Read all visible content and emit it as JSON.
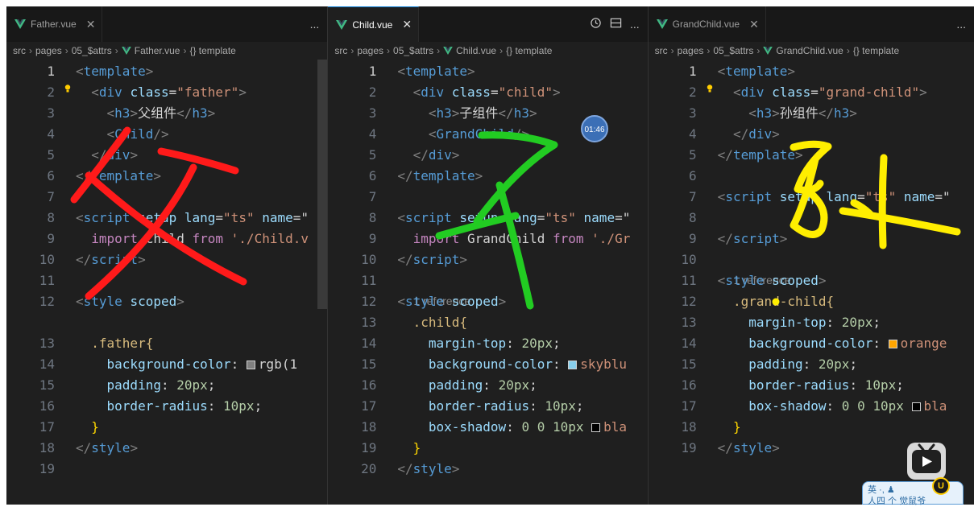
{
  "panes": [
    {
      "tab": {
        "name": "Father.vue",
        "active": false
      },
      "actions": [
        "..."
      ],
      "breadcrumb": [
        "src",
        "pages",
        "05_$attrs",
        "Father.vue",
        "{} template"
      ],
      "lines": [
        {
          "n": "1",
          "tokens": [
            [
              "<",
              "br"
            ],
            [
              "template",
              "tag"
            ],
            [
              ">",
              "br"
            ]
          ]
        },
        {
          "n": "2",
          "tokens": [
            [
              "  <",
              "br"
            ],
            [
              "div",
              "tag"
            ],
            [
              " class",
              "attr"
            ],
            [
              "=",
              "plain"
            ],
            [
              "\"father\"",
              "str"
            ],
            [
              ">",
              "br"
            ]
          ],
          "bulb": true
        },
        {
          "n": "3",
          "tokens": [
            [
              "    <",
              "br"
            ],
            [
              "h3",
              "tag"
            ],
            [
              ">",
              "br"
            ],
            [
              "父组件",
              "txt"
            ],
            [
              "</",
              "br"
            ],
            [
              "h3",
              "tag"
            ],
            [
              ">",
              "br"
            ]
          ]
        },
        {
          "n": "4",
          "tokens": [
            [
              "    <",
              "br"
            ],
            [
              "Child",
              "tag"
            ],
            [
              "/>",
              "br"
            ]
          ]
        },
        {
          "n": "5",
          "tokens": [
            [
              "  </",
              "br"
            ],
            [
              "div",
              "tag"
            ],
            [
              ">",
              "br"
            ]
          ]
        },
        {
          "n": "6",
          "tokens": [
            [
              "</",
              "br"
            ],
            [
              "template",
              "tag"
            ],
            [
              ">",
              "br"
            ]
          ]
        },
        {
          "n": "7",
          "tokens": []
        },
        {
          "n": "8",
          "tokens": [
            [
              "<",
              "br"
            ],
            [
              "script",
              "tag"
            ],
            [
              " setup",
              "attr"
            ],
            [
              " lang",
              "attr"
            ],
            [
              "=",
              "plain"
            ],
            [
              "\"ts\"",
              "str"
            ],
            [
              " name",
              "attr"
            ],
            [
              "=\"",
              "plain"
            ]
          ]
        },
        {
          "n": "9",
          "tokens": [
            [
              "  import",
              "kw"
            ],
            [
              " Child",
              "plain"
            ],
            [
              " from",
              "kw"
            ],
            [
              " './Child.v",
              "str"
            ]
          ]
        },
        {
          "n": "10",
          "tokens": [
            [
              "</",
              "br"
            ],
            [
              "script",
              "tag"
            ],
            [
              ">",
              "br"
            ]
          ]
        },
        {
          "n": "11",
          "tokens": []
        },
        {
          "n": "12",
          "tokens": [
            [
              "<",
              "br"
            ],
            [
              "style",
              "tag"
            ],
            [
              " scoped",
              "attr"
            ],
            [
              ">",
              "br"
            ]
          ]
        },
        {
          "n": "13",
          "tokens": [
            [
              "  .father{",
              "sel"
            ]
          ],
          "gap": true
        },
        {
          "n": "14",
          "tokens": [
            [
              "    background-color",
              "prop"
            ],
            [
              ": ",
              "plain"
            ],
            [
              "SW",
              "#808080"
            ],
            [
              "rgb(1",
              "plain"
            ]
          ]
        },
        {
          "n": "15",
          "tokens": [
            [
              "    padding",
              "prop"
            ],
            [
              ": ",
              "plain"
            ],
            [
              "20px",
              "num"
            ],
            [
              ";",
              "plain"
            ]
          ]
        },
        {
          "n": "16",
          "tokens": [
            [
              "    border-radius",
              "prop"
            ],
            [
              ": ",
              "plain"
            ],
            [
              "10px",
              "num"
            ],
            [
              ";",
              "plain"
            ]
          ]
        },
        {
          "n": "17",
          "tokens": [
            [
              "  }",
              "gold"
            ]
          ]
        },
        {
          "n": "18",
          "tokens": [
            [
              "</",
              "br"
            ],
            [
              "style",
              "tag"
            ],
            [
              ">",
              "br"
            ]
          ]
        },
        {
          "n": "19",
          "tokens": []
        }
      ],
      "current_line": "1"
    },
    {
      "tab": {
        "name": "Child.vue",
        "active": true
      },
      "actions": [
        "history",
        "split",
        "..."
      ],
      "breadcrumb": [
        "src",
        "pages",
        "05_$attrs",
        "Child.vue",
        "{} template"
      ],
      "lines": [
        {
          "n": "1",
          "tokens": [
            [
              "<",
              "br"
            ],
            [
              "template",
              "tag"
            ],
            [
              ">",
              "br"
            ]
          ]
        },
        {
          "n": "2",
          "tokens": [
            [
              "  <",
              "br"
            ],
            [
              "div",
              "tag"
            ],
            [
              " class",
              "attr"
            ],
            [
              "=",
              "plain"
            ],
            [
              "\"child\"",
              "str"
            ],
            [
              ">",
              "br"
            ]
          ]
        },
        {
          "n": "3",
          "tokens": [
            [
              "    <",
              "br"
            ],
            [
              "h3",
              "tag"
            ],
            [
              ">",
              "br"
            ],
            [
              "子组件",
              "txt"
            ],
            [
              "</",
              "br"
            ],
            [
              "h3",
              "tag"
            ],
            [
              ">",
              "br"
            ]
          ]
        },
        {
          "n": "4",
          "tokens": [
            [
              "    <",
              "br"
            ],
            [
              "GrandChild",
              "tag"
            ],
            [
              "/>",
              "br"
            ]
          ]
        },
        {
          "n": "5",
          "tokens": [
            [
              "  </",
              "br"
            ],
            [
              "div",
              "tag"
            ],
            [
              ">",
              "br"
            ]
          ]
        },
        {
          "n": "6",
          "tokens": [
            [
              "</",
              "br"
            ],
            [
              "template",
              "tag"
            ],
            [
              ">",
              "br"
            ]
          ]
        },
        {
          "n": "7",
          "tokens": []
        },
        {
          "n": "8",
          "tokens": [
            [
              "<",
              "br"
            ],
            [
              "script",
              "tag"
            ],
            [
              " setup",
              "attr"
            ],
            [
              " lang",
              "attr"
            ],
            [
              "=",
              "plain"
            ],
            [
              "\"ts\"",
              "str"
            ],
            [
              " name",
              "attr"
            ],
            [
              "=\"",
              "plain"
            ]
          ]
        },
        {
          "n": "9",
          "tokens": [
            [
              "  import",
              "kw"
            ],
            [
              " GrandChild",
              "plain"
            ],
            [
              " from",
              "kw"
            ],
            [
              " './Gr",
              "str"
            ]
          ]
        },
        {
          "n": "10",
          "tokens": [
            [
              "</",
              "br"
            ],
            [
              "script",
              "tag"
            ],
            [
              ">",
              "br"
            ]
          ]
        },
        {
          "n": "11",
          "tokens": []
        },
        {
          "n": "12",
          "tokens": [
            [
              "<",
              "br"
            ],
            [
              "style",
              "tag"
            ],
            [
              " scoped",
              "attr"
            ],
            [
              ">",
              "br"
            ]
          ],
          "ref": "1 reference"
        },
        {
          "n": "13",
          "tokens": [
            [
              "  .child{",
              "sel"
            ]
          ]
        },
        {
          "n": "14",
          "tokens": [
            [
              "    margin-top",
              "prop"
            ],
            [
              ": ",
              "plain"
            ],
            [
              "20px",
              "num"
            ],
            [
              ";",
              "plain"
            ]
          ]
        },
        {
          "n": "15",
          "tokens": [
            [
              "    background-color",
              "prop"
            ],
            [
              ": ",
              "plain"
            ],
            [
              "SW",
              "#87ceeb"
            ],
            [
              "skyblu",
              "str"
            ]
          ]
        },
        {
          "n": "16",
          "tokens": [
            [
              "    padding",
              "prop"
            ],
            [
              ": ",
              "plain"
            ],
            [
              "20px",
              "num"
            ],
            [
              ";",
              "plain"
            ]
          ]
        },
        {
          "n": "17",
          "tokens": [
            [
              "    border-radius",
              "prop"
            ],
            [
              ": ",
              "plain"
            ],
            [
              "10px",
              "num"
            ],
            [
              ";",
              "plain"
            ]
          ]
        },
        {
          "n": "18",
          "tokens": [
            [
              "    box-shadow",
              "prop"
            ],
            [
              ": ",
              "plain"
            ],
            [
              "0 0 10px ",
              "num"
            ],
            [
              "SW",
              "#000000"
            ],
            [
              "bla",
              "str"
            ]
          ]
        },
        {
          "n": "19",
          "tokens": [
            [
              "  }",
              "gold"
            ]
          ]
        },
        {
          "n": "20",
          "tokens": [
            [
              "</",
              "br"
            ],
            [
              "style",
              "tag"
            ],
            [
              ">",
              "br"
            ]
          ]
        }
      ],
      "current_line": "1",
      "timer": "01:46"
    },
    {
      "tab": {
        "name": "GrandChild.vue",
        "active": false
      },
      "actions": [
        "..."
      ],
      "breadcrumb": [
        "src",
        "pages",
        "05_$attrs",
        "GrandChild.vue",
        "{} template"
      ],
      "lines": [
        {
          "n": "1",
          "tokens": [
            [
              "<",
              "br"
            ],
            [
              "template",
              "tag"
            ],
            [
              ">",
              "br"
            ]
          ]
        },
        {
          "n": "2",
          "tokens": [
            [
              "  <",
              "br"
            ],
            [
              "div",
              "tag"
            ],
            [
              " class",
              "attr"
            ],
            [
              "=",
              "plain"
            ],
            [
              "\"grand-child\"",
              "str"
            ],
            [
              ">",
              "br"
            ]
          ],
          "bulb": true
        },
        {
          "n": "3",
          "tokens": [
            [
              "    <",
              "br"
            ],
            [
              "h3",
              "tag"
            ],
            [
              ">",
              "br"
            ],
            [
              "孙组件",
              "txt"
            ],
            [
              "</",
              "br"
            ],
            [
              "h3",
              "tag"
            ],
            [
              ">",
              "br"
            ]
          ]
        },
        {
          "n": "4",
          "tokens": [
            [
              "  </",
              "br"
            ],
            [
              "div",
              "tag"
            ],
            [
              ">",
              "br"
            ]
          ]
        },
        {
          "n": "5",
          "tokens": [
            [
              "</",
              "br"
            ],
            [
              "template",
              "tag"
            ],
            [
              ">",
              "br"
            ]
          ]
        },
        {
          "n": "6",
          "tokens": []
        },
        {
          "n": "7",
          "tokens": [
            [
              "<",
              "br"
            ],
            [
              "script",
              "tag"
            ],
            [
              " setup",
              "attr"
            ],
            [
              " lang",
              "attr"
            ],
            [
              "=",
              "plain"
            ],
            [
              "\"ts\"",
              "str"
            ],
            [
              " name",
              "attr"
            ],
            [
              "=\"",
              "plain"
            ]
          ]
        },
        {
          "n": "8",
          "tokens": []
        },
        {
          "n": "9",
          "tokens": [
            [
              "</",
              "br"
            ],
            [
              "script",
              "tag"
            ],
            [
              ">",
              "br"
            ]
          ]
        },
        {
          "n": "10",
          "tokens": []
        },
        {
          "n": "11",
          "tokens": [
            [
              "<",
              "br"
            ],
            [
              "style",
              "tag"
            ],
            [
              " scoped",
              "attr"
            ],
            [
              ">",
              "br"
            ]
          ],
          "ref": "1 reference"
        },
        {
          "n": "12",
          "tokens": [
            [
              "  .grand-child{",
              "sel"
            ]
          ]
        },
        {
          "n": "13",
          "tokens": [
            [
              "    margin-top",
              "prop"
            ],
            [
              ": ",
              "plain"
            ],
            [
              "20px",
              "num"
            ],
            [
              ";",
              "plain"
            ]
          ]
        },
        {
          "n": "14",
          "tokens": [
            [
              "    background-color",
              "prop"
            ],
            [
              ": ",
              "plain"
            ],
            [
              "SW",
              "#ffa500"
            ],
            [
              "orange",
              "str"
            ]
          ]
        },
        {
          "n": "15",
          "tokens": [
            [
              "    padding",
              "prop"
            ],
            [
              ": ",
              "plain"
            ],
            [
              "20px",
              "num"
            ],
            [
              ";",
              "plain"
            ]
          ]
        },
        {
          "n": "16",
          "tokens": [
            [
              "    border-radius",
              "prop"
            ],
            [
              ": ",
              "plain"
            ],
            [
              "10px",
              "num"
            ],
            [
              ";",
              "plain"
            ]
          ]
        },
        {
          "n": "17",
          "tokens": [
            [
              "    box-shadow",
              "prop"
            ],
            [
              ": ",
              "plain"
            ],
            [
              "0 0 10px ",
              "num"
            ],
            [
              "SW",
              "#000000"
            ],
            [
              "bla",
              "str"
            ]
          ]
        },
        {
          "n": "18",
          "tokens": [
            [
              "  }",
              "gold"
            ]
          ]
        },
        {
          "n": "19",
          "tokens": [
            [
              "</",
              "br"
            ],
            [
              "style",
              "tag"
            ],
            [
              ">",
              "br"
            ]
          ]
        }
      ],
      "current_line": "1"
    }
  ],
  "annotations": {
    "red_char": "父",
    "green_char": "子",
    "yellow_char": "孙",
    "red_color": "#ff1a1a",
    "green_color": "#22cc22",
    "yellow_color": "#ffee00"
  },
  "overlay_badge": {
    "line1": "英 ·, ♟",
    "line2": "人四 个   觉鼠爷"
  },
  "colors": {
    "editor_bg": "#1f1f1f",
    "tab_bg": "#181818",
    "accent": "#0078d4"
  }
}
